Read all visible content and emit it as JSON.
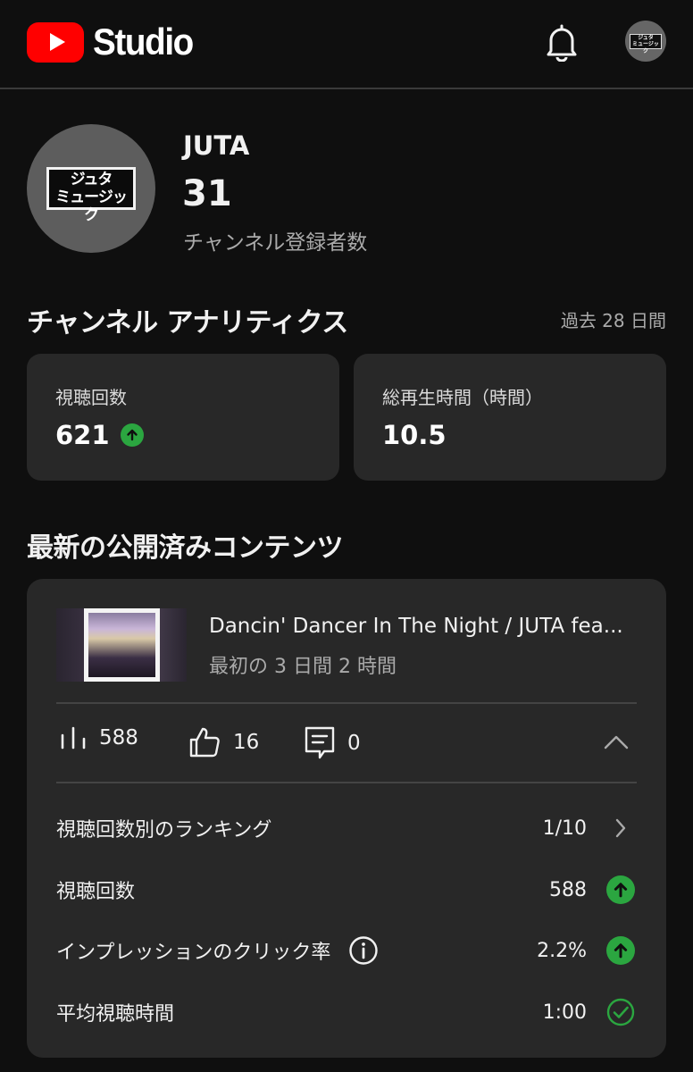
{
  "header": {
    "app_name": "Studio",
    "logo": "youtube-play-icon",
    "notification_icon": "bell-icon",
    "avatar_text": "ジュタ ミュージック"
  },
  "channel": {
    "avatar_text_line1": "ジュタ",
    "avatar_text_line2": "ミュージック",
    "name": "JUTA",
    "subscribers": "31",
    "subscribers_label": "チャンネル登録者数"
  },
  "analytics": {
    "title": "チャンネル アナリティクス",
    "period": "過去 28 日間",
    "views_label": "視聴回数",
    "views_value": "621",
    "views_trend": "up",
    "watch_time_label": "総再生時間（時間）",
    "watch_time_value": "10.5"
  },
  "latest": {
    "title": "最新の公開済みコンテンツ",
    "video_title": "Dancin' Dancer In The Night / JUTA fea...",
    "video_period": "最初の 3 日間 2 時間",
    "views": "588",
    "likes": "16",
    "comments": "0",
    "rows": [
      {
        "label": "視聴回数別のランキング",
        "value": "1/10",
        "icon": "chevron-right-icon"
      },
      {
        "label": "視聴回数",
        "value": "588",
        "icon": "arrow-up-circle-icon"
      },
      {
        "label": "インプレッションのクリック率",
        "value": "2.2%",
        "icon": "arrow-up-circle-icon"
      },
      {
        "label": "平均視聴時間",
        "value": "1:00",
        "icon": "check-circle-icon"
      }
    ]
  },
  "colors": {
    "background": "#0f0f0f",
    "card": "#282828",
    "brand_red": "#ff0000",
    "trend_green": "#2ba640"
  }
}
